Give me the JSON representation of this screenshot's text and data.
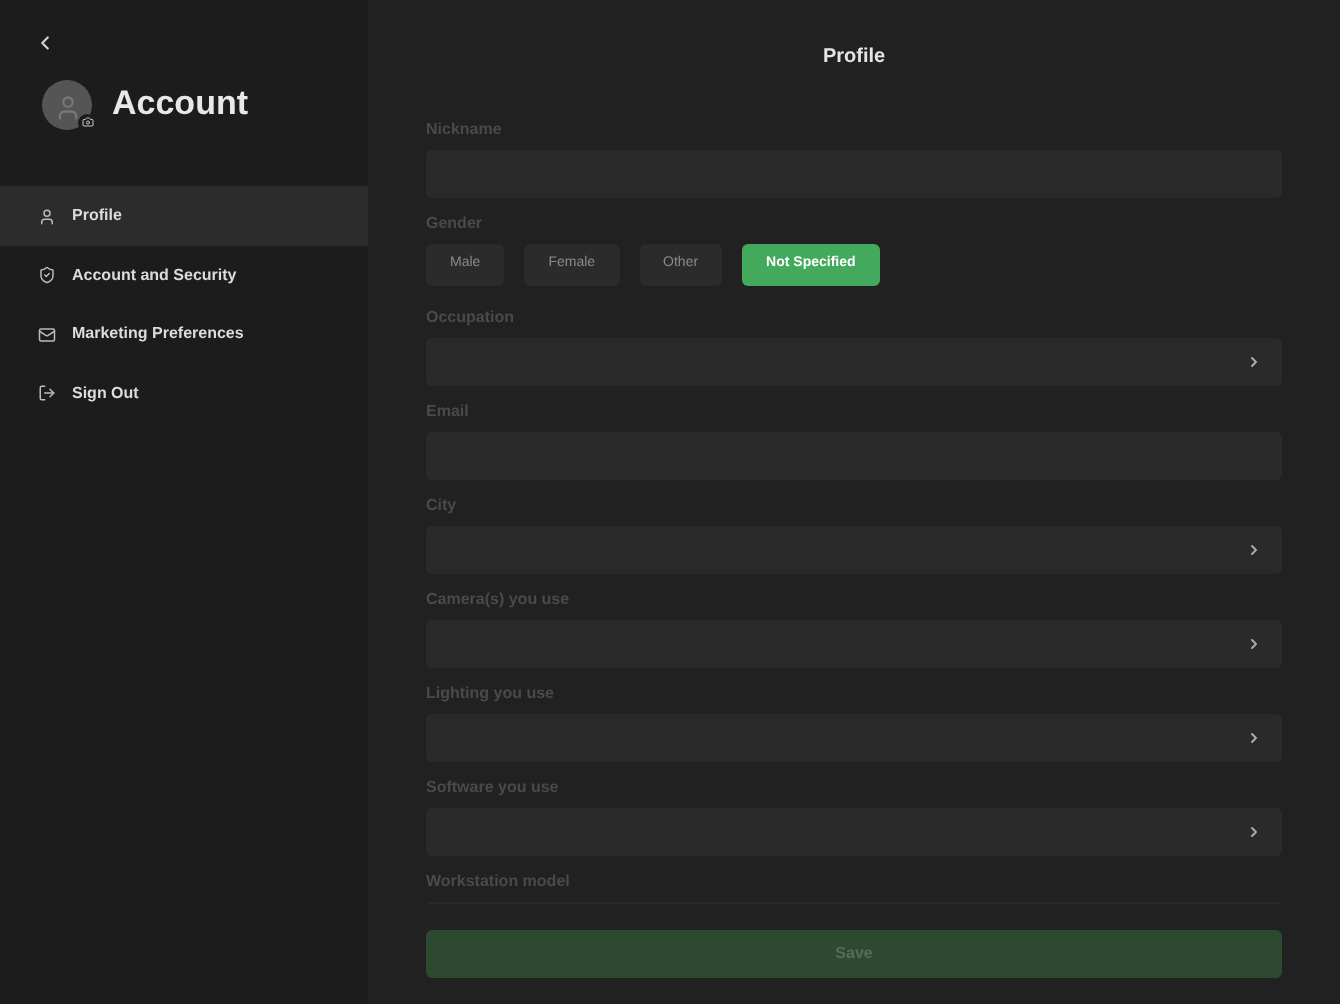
{
  "sidebar": {
    "title": "Account",
    "items": [
      {
        "label": "Profile",
        "kind": "user",
        "selected": true
      },
      {
        "label": "Account and Security",
        "kind": "shield",
        "selected": false
      },
      {
        "label": "Marketing Preferences",
        "kind": "mail",
        "selected": false
      },
      {
        "label": "Sign Out",
        "kind": "signout",
        "selected": false
      }
    ]
  },
  "page_title": "Profile",
  "fields": [
    {
      "kind": "text",
      "label": "Nickname"
    },
    {
      "kind": "choice",
      "label": "Gender",
      "options": [
        {
          "label": "Male",
          "selected": false
        },
        {
          "label": "Female",
          "selected": false
        },
        {
          "label": "Other",
          "selected": false
        },
        {
          "label": "Not Specified",
          "selected": true
        }
      ]
    },
    {
      "kind": "select",
      "label": "Occupation"
    },
    {
      "kind": "text",
      "label": "Email"
    },
    {
      "kind": "select",
      "label": "City"
    },
    {
      "kind": "select",
      "label": "Camera(s) you use"
    },
    {
      "kind": "select",
      "label": "Lighting you use"
    },
    {
      "kind": "select",
      "label": "Software you use"
    },
    {
      "kind": "text",
      "label": "Workstation model"
    }
  ],
  "save_button": {
    "label": "Save",
    "disabled": true
  }
}
